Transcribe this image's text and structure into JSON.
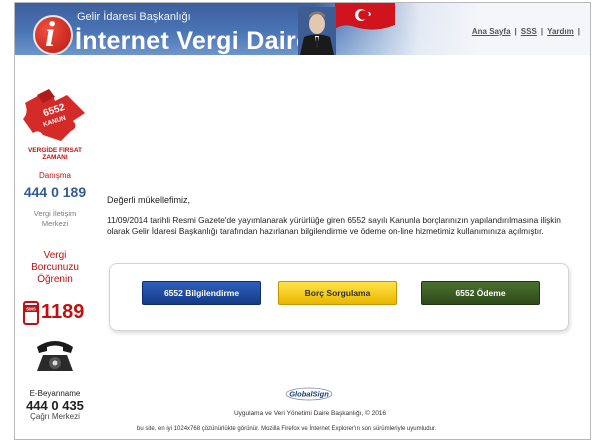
{
  "header": {
    "org_name": "Gelir İdaresi Başkanlığı",
    "site_title": "İnternet Vergi Dairesi",
    "logo_letter": "i",
    "nav": [
      {
        "label": "Ana Sayfa"
      },
      {
        "label": "SSS"
      },
      {
        "label": "Yardım"
      }
    ]
  },
  "sidebar": {
    "promo_puzzle_line1": "6552",
    "promo_puzzle_line2": "KANUN",
    "promo_caption": "VERGİDE FIRSAT ZAMANI",
    "danisma_label": "Danışma",
    "danisma_number": "444 0 189",
    "vim_label_1": "Vergi İletişim",
    "vim_label_2": "Merkezi",
    "vergi_borc_1": "Vergi",
    "vergi_borc_2": "Borcunuzu",
    "vergi_borc_3": "Öğrenin",
    "sms_label": "SMS",
    "sms_number": "1189",
    "ebeyan_label": "E-Beyanname",
    "ebeyan_number": "444 0 435",
    "cagri_label": "Çağrı Merkezi"
  },
  "main": {
    "greeting": "Değerli mükellefimiz,",
    "body": "11/09/2014 tarihli Resmi Gazete'de yayımlanarak yürürlüğe giren 6552 sayılı Kanunla borçlarınızın yapılandırılmasına ilişkin olarak Gelir İdaresi Başkanlığı tarafından hazırlanan bilgilendirme ve ödeme on-line hizmetimiz kullanımınıza açılmıştır.",
    "buttons": {
      "info": "6552 Bilgilendirme",
      "debt": "Borç Sorgulama",
      "payment": "6552 Ödeme"
    }
  },
  "footer": {
    "globalsign": "GlobalSign",
    "copyright": "Uygulama ve Veri Yönetimi Daire Başkanlığı, © 2016",
    "browser_note": "bu site, en iyi 1024x768 çözünürlükte görünür. Mozilla Firefox ve İnternet Explorer'ın son sürümleriyle uyumludur."
  },
  "colors": {
    "header_blue": "#4a74b4",
    "brand_red": "#c01010",
    "button_blue": "#1f4ca4",
    "button_yellow": "#f5cc1a",
    "button_green": "#3a5a24"
  }
}
